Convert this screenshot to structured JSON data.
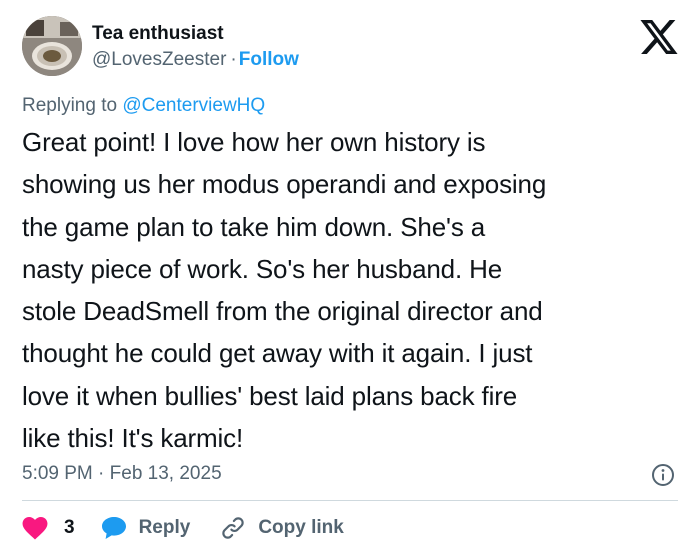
{
  "author": {
    "display_name": "Tea enthusiast",
    "handle": "@LovesZeester",
    "separator": "·",
    "follow_label": "Follow"
  },
  "reply_context": {
    "prefix": "Replying to",
    "mention": "@CenterviewHQ"
  },
  "tweet": {
    "text": "Great point!  I love how her own history is\nshowing us her modus operandi and exposing\nthe game plan to take him down.  She's a\nnasty piece of work.  So's her husband.  He\nstole DeadSmell from the original director and\nthought he could get away with it again.  I just\nlove it when bullies' best laid plans back fire\nlike this!  It's karmic!",
    "time": "5:09 PM",
    "separator": "·",
    "date": "Feb 13, 2025"
  },
  "actions": {
    "like_count": "3",
    "reply_label": "Reply",
    "copy_link_label": "Copy link"
  },
  "icons": {
    "brand": "x-logo-icon",
    "info": "info-icon",
    "like": "heart-icon",
    "reply": "speech-bubble-icon",
    "copy": "link-icon"
  },
  "colors": {
    "text": "#0f1419",
    "secondary": "#536471",
    "accent": "#1d9bf0",
    "like": "#f91880",
    "divider": "#cfd9de"
  }
}
